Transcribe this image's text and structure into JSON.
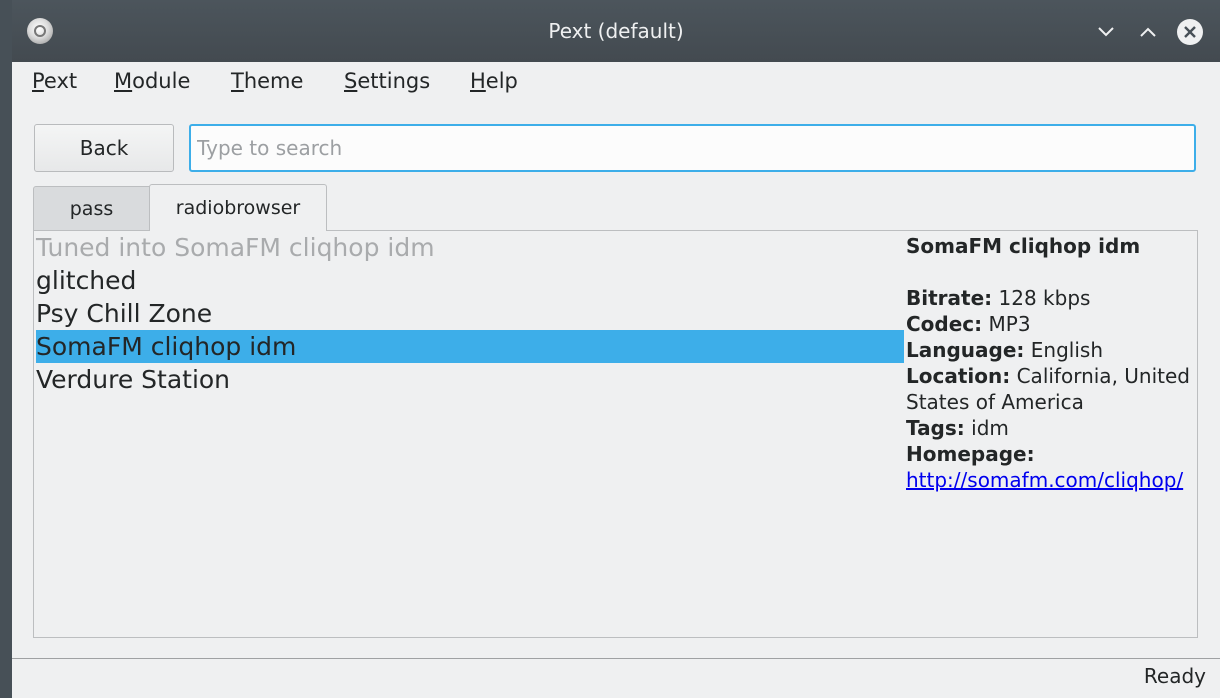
{
  "window": {
    "title": "Pext (default)"
  },
  "menu": [
    "Pext",
    "Module",
    "Theme",
    "Settings",
    "Help"
  ],
  "toolbar": {
    "back_label": "Back",
    "search_placeholder": "Type to search",
    "search_value": ""
  },
  "tabs": [
    {
      "label": "pass",
      "active": false
    },
    {
      "label": "radiobrowser",
      "active": true
    }
  ],
  "list": {
    "header": "Tuned into SomaFM cliqhop idm",
    "items": [
      "glitched",
      "Psy Chill Zone",
      "SomaFM cliqhop idm",
      "Verdure Station"
    ],
    "selected_index": 2
  },
  "info": {
    "name": "SomaFM cliqhop idm",
    "fields": [
      {
        "label": "Bitrate:",
        "value": "128 kbps"
      },
      {
        "label": "Codec:",
        "value": "MP3"
      },
      {
        "label": "Language:",
        "value": "English"
      },
      {
        "label": "Location:",
        "value": "California, United States of America"
      },
      {
        "label": "Tags:",
        "value": "idm"
      }
    ],
    "homepage_label": "Homepage:",
    "homepage_link": "http://somafm.com/cliqhop/"
  },
  "status": "Ready",
  "colors": {
    "accent": "#3daee9",
    "titlebar": "#475057",
    "link": "#0000ee"
  },
  "icons": {
    "app": "pext-app-icon",
    "minimize": "chevron-down-icon",
    "maximize": "chevron-up-icon",
    "close": "close-icon"
  }
}
